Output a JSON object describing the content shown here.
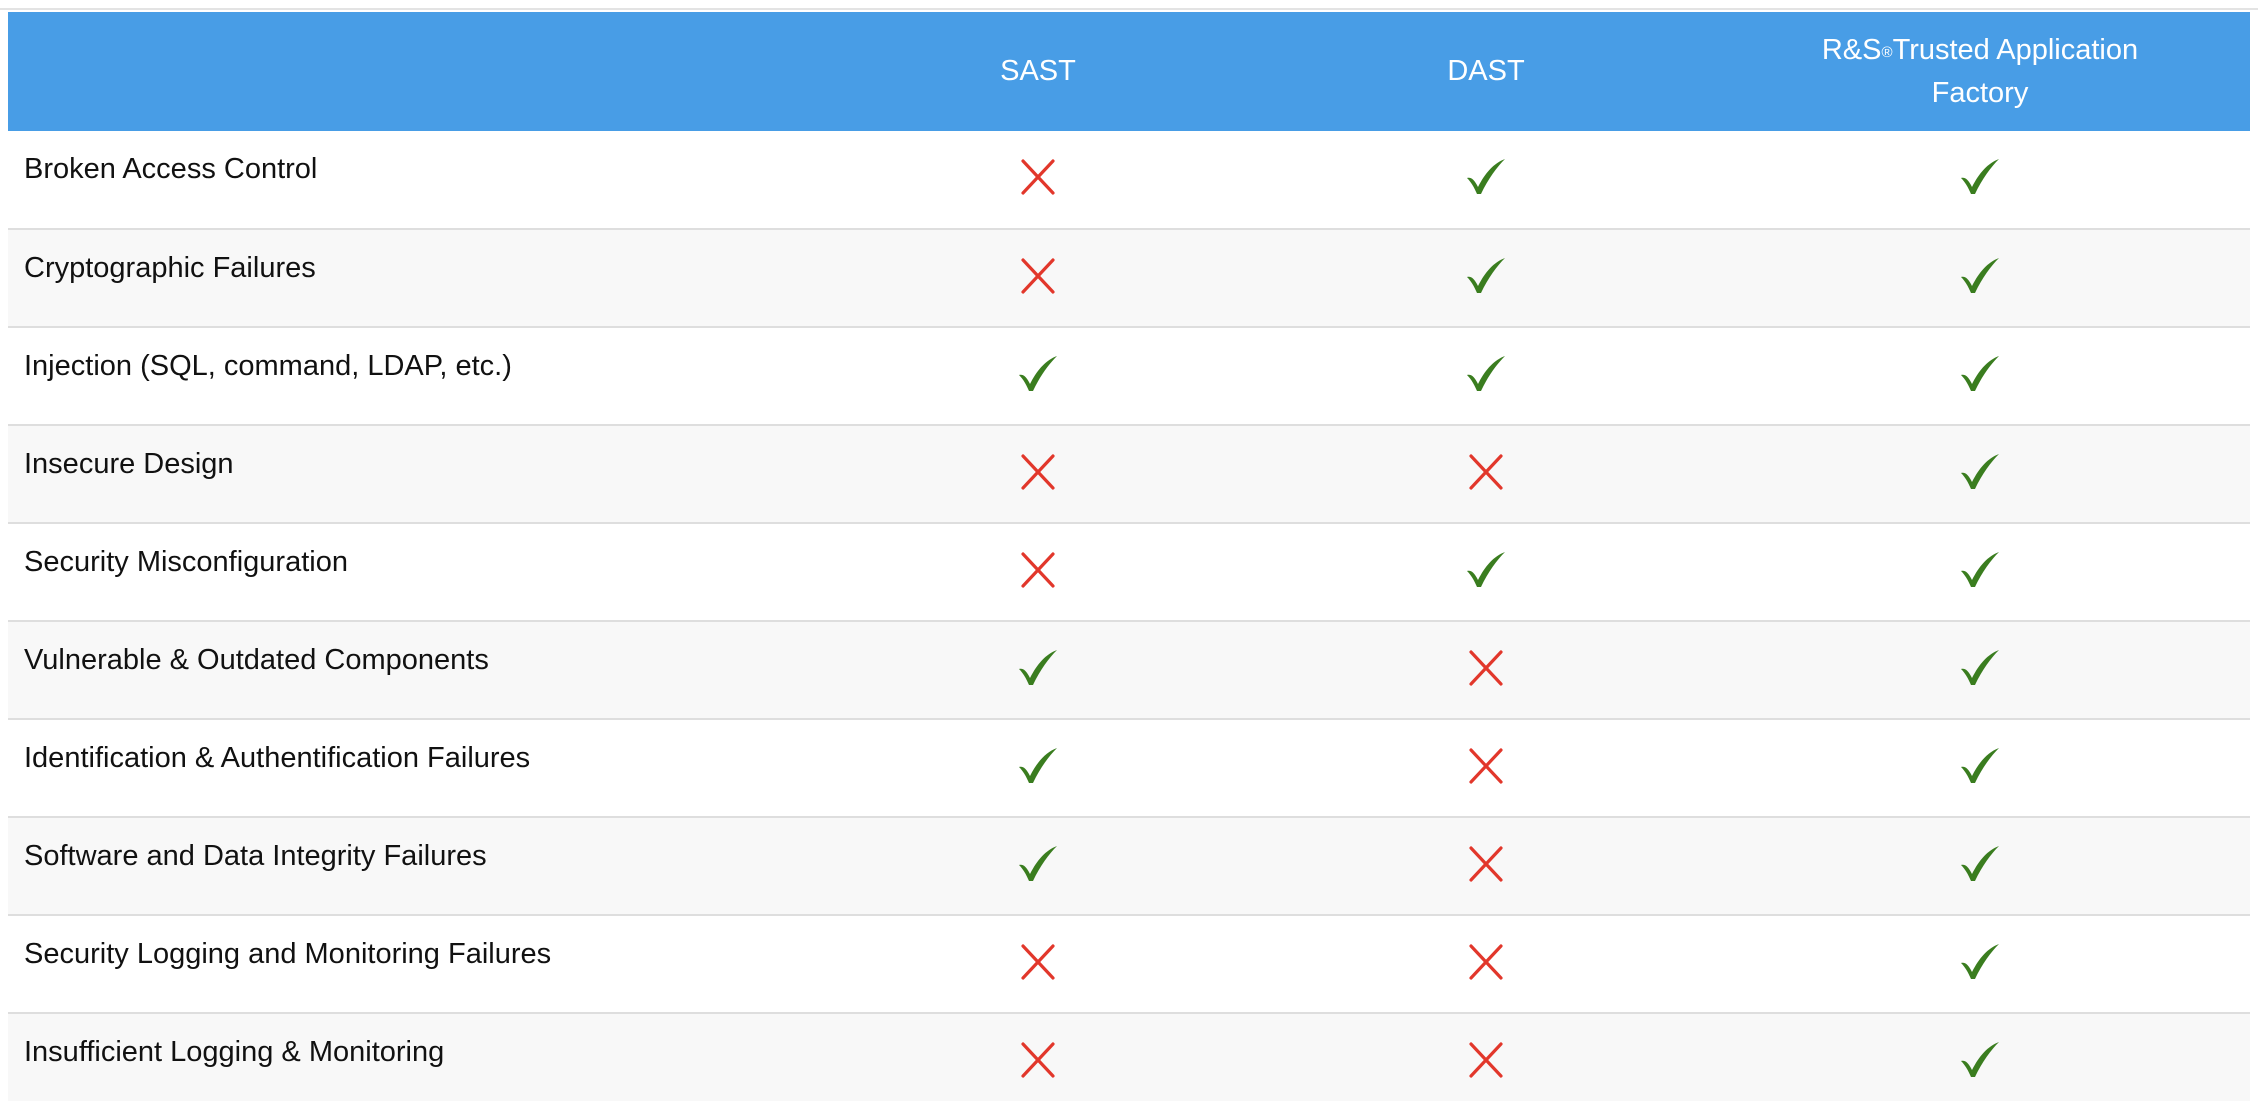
{
  "table": {
    "columns": [
      "",
      "SAST",
      "DAST",
      "R&S",
      "®",
      "Trusted Application Factory"
    ],
    "header": {
      "label_col": "",
      "sast": "SAST",
      "dast": "DAST",
      "rs_prefix": "R&S",
      "rs_reg": "®",
      "rs_rest": "Trusted Application",
      "rs_line2": "Factory"
    },
    "rows": [
      {
        "label": "Broken Access Control",
        "sast": "cross",
        "dast": "check",
        "rs": "check"
      },
      {
        "label": "Cryptographic Failures",
        "sast": "cross",
        "dast": "check",
        "rs": "check"
      },
      {
        "label": "Injection (SQL, command, LDAP, etc.)",
        "sast": "check",
        "dast": "check",
        "rs": "check"
      },
      {
        "label": "Insecure Design",
        "sast": "cross",
        "dast": "cross",
        "rs": "check"
      },
      {
        "label": "Security Misconfiguration",
        "sast": "cross",
        "dast": "check",
        "rs": "check"
      },
      {
        "label": "Vulnerable & Outdated Components",
        "sast": "check",
        "dast": "cross",
        "rs": "check"
      },
      {
        "label": "Identification & Authentification Failures",
        "sast": "check",
        "dast": "cross",
        "rs": "check"
      },
      {
        "label": "Software and Data Integrity Failures",
        "sast": "check",
        "dast": "cross",
        "rs": "check"
      },
      {
        "label": "Security Logging and Monitoring Failures",
        "sast": "cross",
        "dast": "cross",
        "rs": "check"
      },
      {
        "label": "Insufficient Logging & Monitoring",
        "sast": "cross",
        "dast": "cross",
        "rs": "check"
      }
    ]
  },
  "icons": {
    "check": "check-icon",
    "cross": "cross-icon"
  },
  "colors": {
    "header_bg": "#489de6",
    "check": "#3a7d1f",
    "cross": "#e2372b"
  }
}
